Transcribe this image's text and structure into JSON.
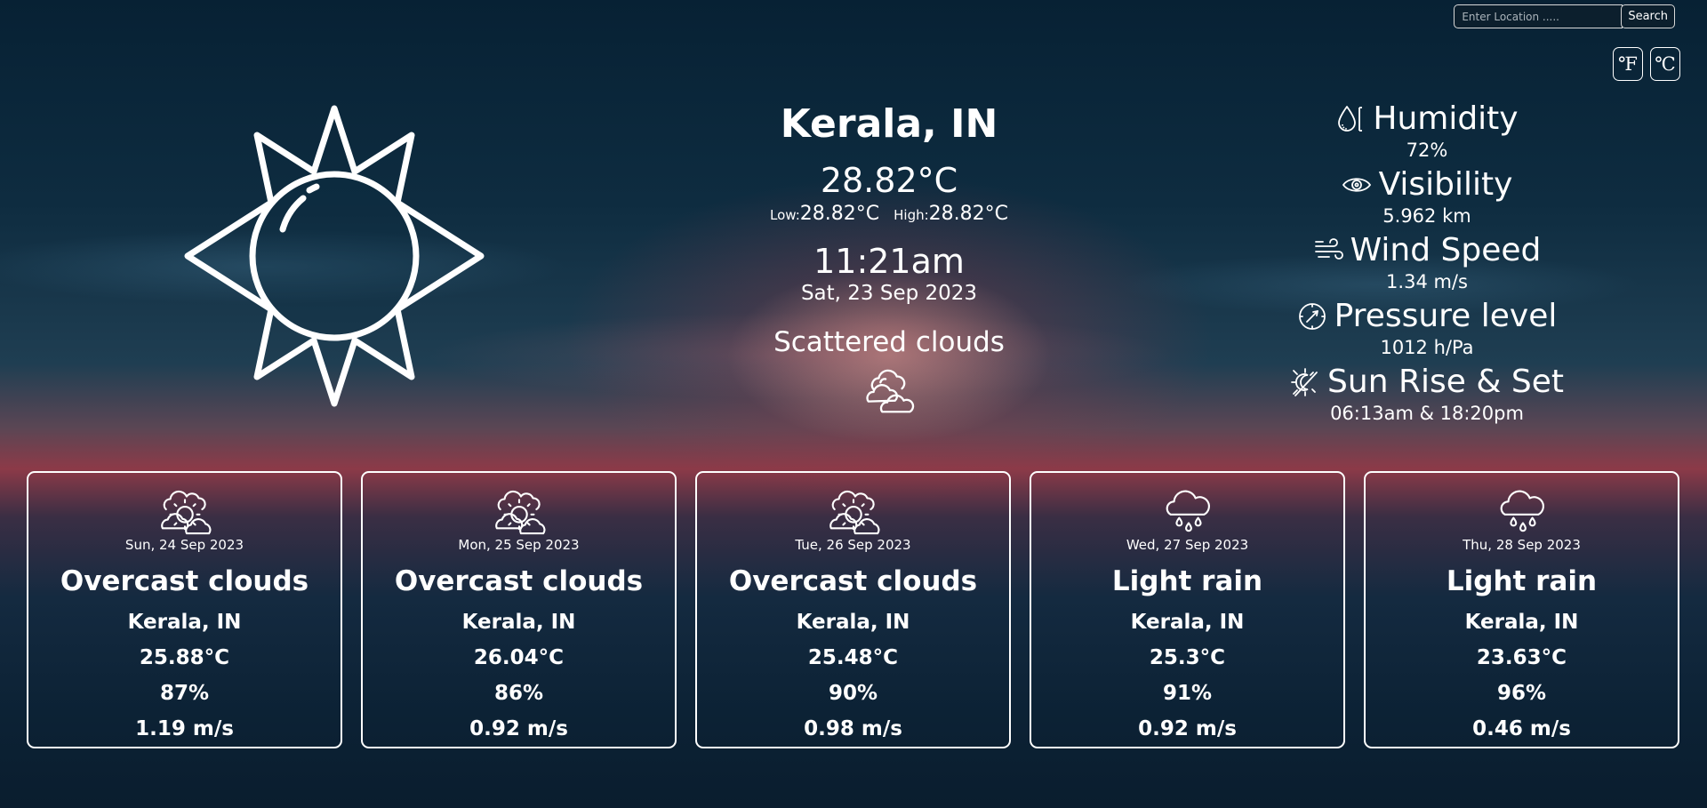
{
  "search": {
    "placeholder": "Enter Location .....",
    "button_label": "Search"
  },
  "units": {
    "fahrenheit": "℉",
    "celsius": "℃"
  },
  "current": {
    "icon": "sun-icon",
    "city": "Kerala, IN",
    "temp": "28.82°C",
    "low_label": "Low:",
    "low": "28.82°C",
    "high_label": "High:",
    "high": "28.82°C",
    "time": "11:21am",
    "date": "Sat, 23 Sep 2023",
    "description": "Scattered clouds",
    "description_icon": "scattered-clouds-icon"
  },
  "details": [
    {
      "icon": "humidity-icon",
      "label": "Humidity",
      "value": "72%"
    },
    {
      "icon": "eye-icon",
      "label": "Visibility",
      "value": "5.962 km"
    },
    {
      "icon": "wind-icon",
      "label": "Wind Speed",
      "value": "1.34 m/s"
    },
    {
      "icon": "compass-icon",
      "label": "Pressure level",
      "value": "1012 h/Pa"
    },
    {
      "icon": "sunrise-icon",
      "label": "Sun Rise & Set",
      "value": "06:13am & 18:20pm"
    }
  ],
  "forecast": [
    {
      "icon": "sun-cloud-icon",
      "date": "Sun, 24 Sep 2023",
      "desc": "Overcast clouds",
      "city": "Kerala, IN",
      "temp": "25.88°C",
      "humidity": "87%",
      "wind": "1.19 m/s"
    },
    {
      "icon": "sun-cloud-icon",
      "date": "Mon, 25 Sep 2023",
      "desc": "Overcast clouds",
      "city": "Kerala, IN",
      "temp": "26.04°C",
      "humidity": "86%",
      "wind": "0.92 m/s"
    },
    {
      "icon": "sun-cloud-icon",
      "date": "Tue, 26 Sep 2023",
      "desc": "Overcast clouds",
      "city": "Kerala, IN",
      "temp": "25.48°C",
      "humidity": "90%",
      "wind": "0.98 m/s"
    },
    {
      "icon": "rain-cloud-icon",
      "date": "Wed, 27 Sep 2023",
      "desc": "Light rain",
      "city": "Kerala, IN",
      "temp": "25.3°C",
      "humidity": "91%",
      "wind": "0.92 m/s"
    },
    {
      "icon": "rain-cloud-icon",
      "date": "Thu, 28 Sep 2023",
      "desc": "Light rain",
      "city": "Kerala, IN",
      "temp": "23.63°C",
      "humidity": "96%",
      "wind": "0.46 m/s"
    }
  ]
}
